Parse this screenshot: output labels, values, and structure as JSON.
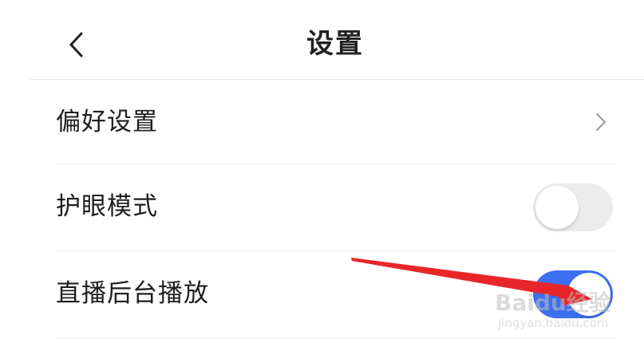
{
  "header": {
    "title": "设置",
    "back_icon": "chevron-left-icon"
  },
  "settings": [
    {
      "label": "偏好设置",
      "control": "chevron-right-icon"
    },
    {
      "label": "护眼模式",
      "control": "toggle",
      "state": "off"
    },
    {
      "label": "直播后台播放",
      "control": "toggle",
      "state": "on"
    }
  ],
  "colors": {
    "toggle_on": "#3d6ff0",
    "toggle_off": "#ececec",
    "annotation_arrow": "#e8262a"
  },
  "watermark": {
    "text": "Baidu经验",
    "sub": "jingyan.baidu.com"
  }
}
